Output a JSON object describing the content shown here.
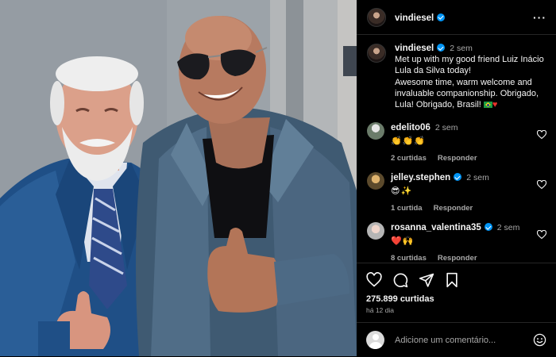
{
  "post": {
    "username": "vindiesel",
    "verified": true
  },
  "caption": {
    "username": "vindiesel",
    "time": "2 sem",
    "text": "Met up with my good friend Luiz Inácio Lula da Silva today!\nAwesome time, warm welcome and invaluable companionship. Obrigado, Lula! Obrigado, Brasil!",
    "emojis": [
      "brazil-flag",
      "red-heart"
    ]
  },
  "comments": [
    {
      "username": "edelito06",
      "verified": false,
      "time": "2 sem",
      "emoji_text": "👏👏👏",
      "likes": "2 curtidas",
      "reply": "Responder"
    },
    {
      "username": "jelley.stephen",
      "verified": true,
      "time": "2 sem",
      "emoji_text": "😎✨",
      "likes": "1 curtida",
      "reply": "Responder"
    },
    {
      "username": "rosanna_valentina35",
      "verified": true,
      "time": "2 sem",
      "emoji_text": "❤️🙌",
      "likes": "8 curtidas",
      "reply": "Responder"
    }
  ],
  "actions": {
    "icons": [
      "heart-icon",
      "comment-icon",
      "share-icon",
      "bookmark-icon"
    ],
    "likes_count": "275.899 curtidas",
    "posted_ago": "há 12 dia"
  },
  "add_comment": {
    "placeholder": "Adicione um comentário...",
    "emoji_icon": "smiley-icon"
  },
  "colors": {
    "background": "#000000",
    "text": "#f5f5f5",
    "muted": "#a8a8a8",
    "verified": "#0095f6",
    "divider": "#262626"
  }
}
